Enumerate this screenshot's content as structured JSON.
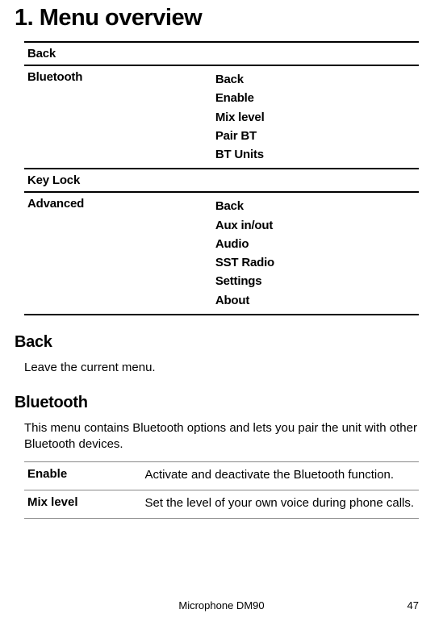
{
  "title": "1. Menu overview",
  "menu": {
    "rows": [
      {
        "left": "Back",
        "right": []
      },
      {
        "left": "Bluetooth",
        "right": [
          "Back",
          "Enable",
          "Mix level",
          "Pair BT",
          "BT Units"
        ]
      },
      {
        "left": "Key Lock",
        "right": []
      },
      {
        "left": "Advanced",
        "right": [
          "Back",
          "Aux in/out",
          "Audio",
          "SST Radio",
          "Settings",
          "About"
        ]
      }
    ]
  },
  "sections": {
    "back": {
      "heading": "Back",
      "body": "Leave the current menu."
    },
    "bluetooth": {
      "heading": "Bluetooth",
      "body": "This menu contains Bluetooth options and lets you pair the unit with other Bluetooth devices.",
      "defs": [
        {
          "term": "Enable",
          "desc": "Activate and deactivate the Bluetooth function."
        },
        {
          "term": "Mix level",
          "desc": "Set the level of your own voice during phone calls."
        }
      ]
    }
  },
  "footer": {
    "product": "Microphone DM90",
    "page": "47"
  }
}
